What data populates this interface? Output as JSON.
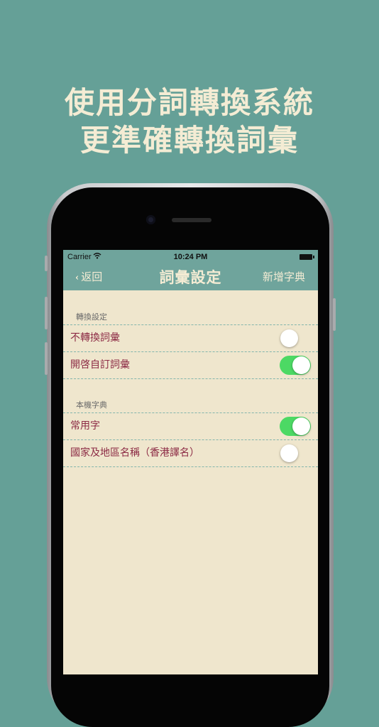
{
  "headline": {
    "line1": "使用分詞轉換系統",
    "line2": "更準確轉換詞彙"
  },
  "status_bar": {
    "carrier": "Carrier",
    "time": "10:24 PM"
  },
  "nav": {
    "back_label": "返回",
    "title": "詞彙設定",
    "add_label": "新增字典"
  },
  "sections": [
    {
      "header": "轉換設定",
      "rows": [
        {
          "label": "不轉換詞彙",
          "enabled": false
        },
        {
          "label": "開啓自訂詞彙",
          "enabled": true
        }
      ]
    },
    {
      "header": "本機字典",
      "rows": [
        {
          "label": "常用字",
          "enabled": true
        },
        {
          "label": "國家及地區名稱（香港譯名）",
          "enabled": false
        }
      ]
    }
  ],
  "colors": {
    "background": "#65a097",
    "nav_bar": "#6fa49c",
    "screen": "#efe6cd",
    "row_label": "#8c2b45",
    "toggle_on": "#4cd964",
    "divider": "#83b5ac"
  }
}
